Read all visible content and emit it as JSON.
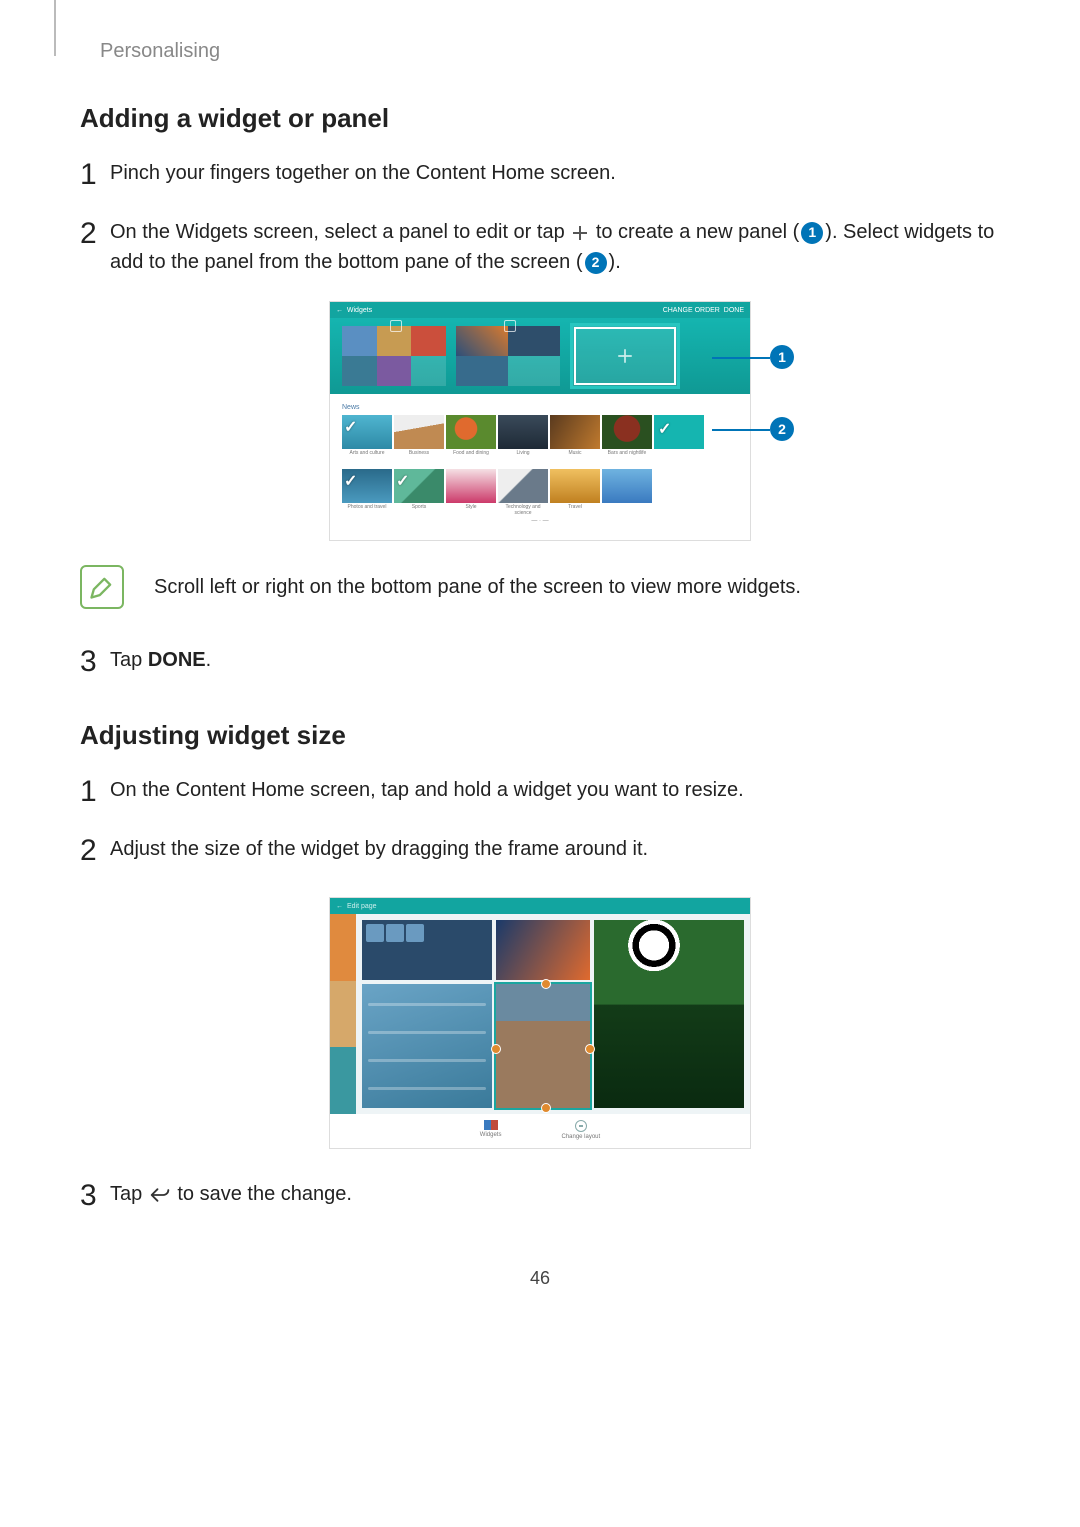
{
  "header": {
    "breadcrumb": "Personalising"
  },
  "section1": {
    "title": "Adding a widget or panel",
    "step1": "Pinch your fingers together on the Content Home screen.",
    "step2_a": "On the Widgets screen, select a panel to edit or tap ",
    "step2_b": " to create a new panel (",
    "step2_c": "). Select widgets to add to the panel from the bottom pane of the screen (",
    "step2_d": ").",
    "fig1": {
      "hdr_back": "←",
      "hdr_title": "Widgets",
      "hdr_right_a": "CHANGE ORDER",
      "hdr_right_b": "DONE",
      "wa_title": "News",
      "row1_labels": [
        "Arts and culture",
        "Business",
        "Food and dining",
        "Living",
        "Music",
        "Bars and nightlife",
        ""
      ],
      "row2_labels": [
        "Photos and travel",
        "Sports",
        "Style",
        "Technology and science",
        "Travel",
        ""
      ],
      "footer": "— · —"
    },
    "note": "Scroll left or right on the bottom pane of the screen to view more widgets.",
    "step3_a": "Tap ",
    "step3_b": "DONE",
    "step3_c": "."
  },
  "section2": {
    "title": "Adjusting widget size",
    "step1": "On the Content Home screen, tap and hold a widget you want to resize.",
    "step2": "Adjust the size of the widget by dragging the frame around it.",
    "fig2": {
      "hdr_back": "←",
      "hdr_title": "Edit page",
      "footer_a": "Widgets",
      "footer_b": "Change layout"
    },
    "step3_a": "Tap ",
    "step3_b": " to save the change."
  },
  "callouts": {
    "c1": "1",
    "c2": "2"
  },
  "page_number": "46"
}
